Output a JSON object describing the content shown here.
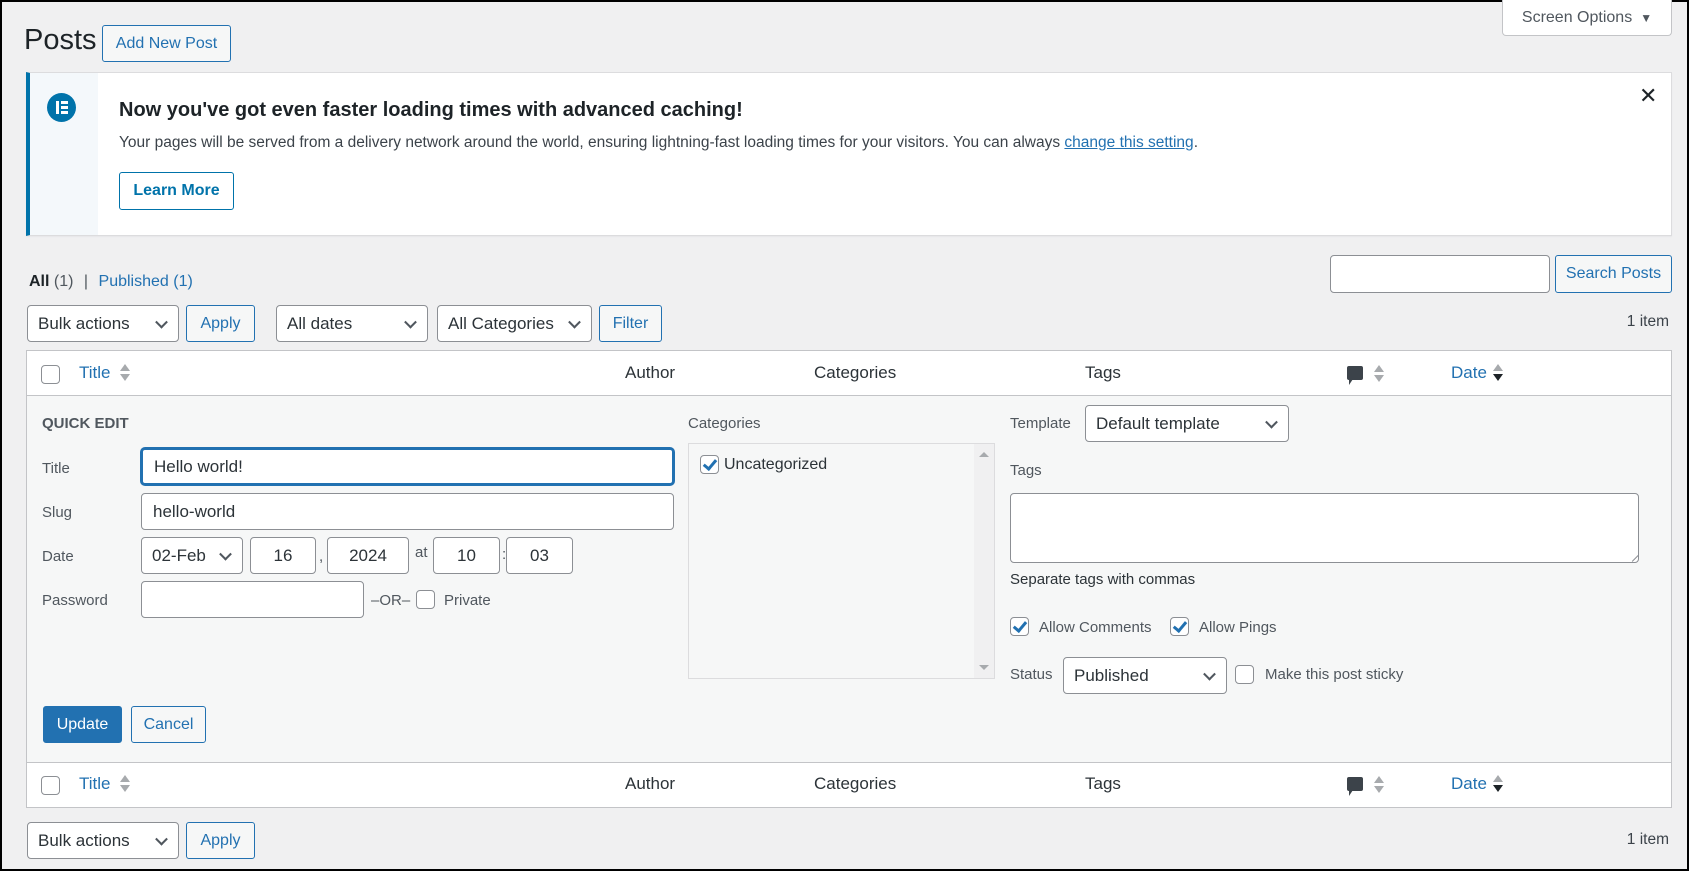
{
  "header": {
    "page_title": "Posts",
    "add_new_label": "Add New Post",
    "screen_options_label": "Screen Options"
  },
  "notice": {
    "icon": "elementor-logo-icon",
    "heading": "Now you've got even faster loading times with advanced caching!",
    "body_prefix": "Your pages will be served from a delivery network around the world, ensuring lightning-fast loading times for your visitors. You can always ",
    "link_text": "change this setting",
    "body_suffix": ".",
    "learn_more_label": "Learn More",
    "close_icon": "close-icon",
    "accent_color": "#0073aa"
  },
  "views": {
    "all_label": "All",
    "all_count": "(1)",
    "separator": "|",
    "published_label": "Published",
    "published_count": "(1)"
  },
  "search": {
    "value": "",
    "button_label": "Search Posts"
  },
  "tablenav_top": {
    "bulk_actions": "Bulk actions",
    "apply_label": "Apply",
    "dates_filter": "All dates",
    "categories_filter": "All Categories",
    "filter_label": "Filter",
    "item_count": "1 item"
  },
  "columns": {
    "title": "Title",
    "author": "Author",
    "categories": "Categories",
    "tags": "Tags",
    "comments_icon": "comment-bubble-icon",
    "date": "Date"
  },
  "quick_edit": {
    "heading": "QUICK EDIT",
    "title_label": "Title",
    "title_value": "Hello world!",
    "slug_label": "Slug",
    "slug_value": "hello-world",
    "date_label": "Date",
    "month_value": "02-Feb",
    "day_value": "16",
    "comma": ",",
    "year_value": "2024",
    "at_label": "at",
    "hour_value": "10",
    "colon": ":",
    "minute_value": "03",
    "password_label": "Password",
    "password_value": "",
    "or_label": "–OR–",
    "private_label": "Private",
    "private_checked": false,
    "categories_label": "Categories",
    "categories": [
      {
        "label": "Uncategorized",
        "checked": true
      }
    ],
    "template_label": "Template",
    "template_value": "Default template",
    "tags_label": "Tags",
    "tags_value": "",
    "tags_hint": "Separate tags with commas",
    "allow_comments_label": "Allow Comments",
    "allow_comments_checked": true,
    "allow_pings_label": "Allow Pings",
    "allow_pings_checked": true,
    "status_label": "Status",
    "status_value": "Published",
    "sticky_label": "Make this post sticky",
    "sticky_checked": false,
    "update_label": "Update",
    "cancel_label": "Cancel"
  },
  "tablenav_bottom": {
    "bulk_actions": "Bulk actions",
    "apply_label": "Apply",
    "item_count": "1 item"
  }
}
